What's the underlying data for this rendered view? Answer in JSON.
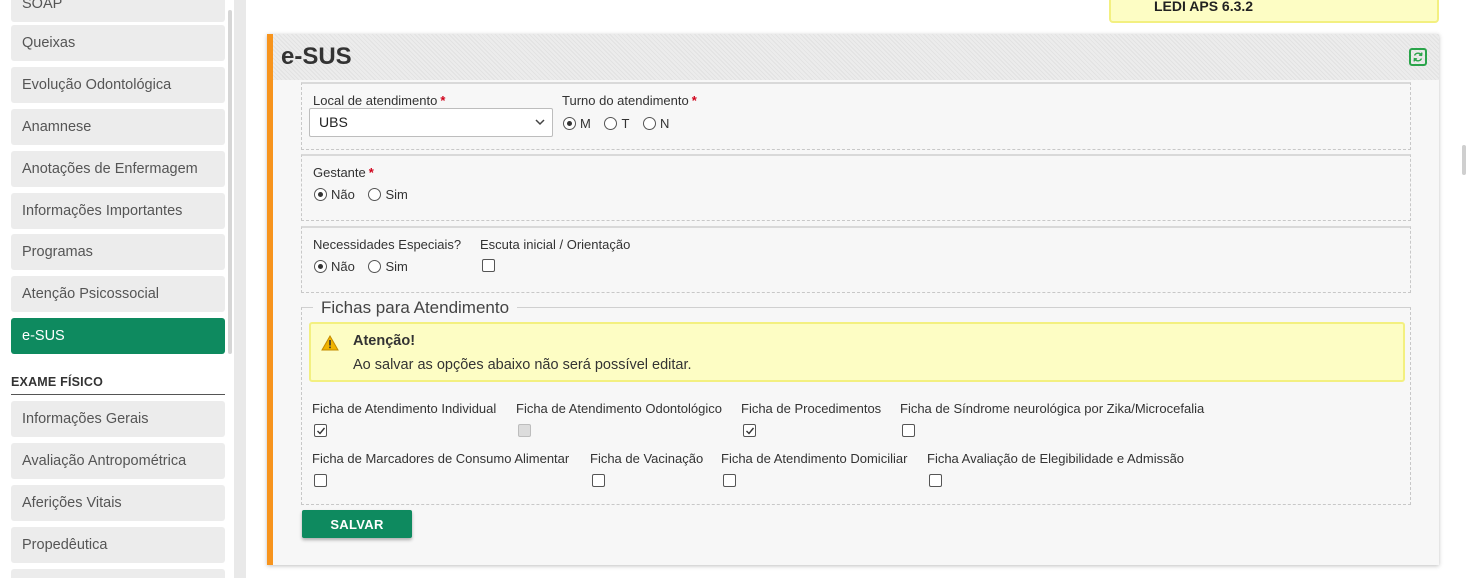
{
  "sidebar": {
    "items_top": [
      "SOAP",
      "Queixas",
      "Evolução Odontológica",
      "Anamnese",
      "Anotações de Enfermagem",
      "Informações Importantes",
      "Programas",
      "Atenção Psicossocial",
      "e-SUS"
    ],
    "active_item": "e-SUS",
    "section_header": "EXAME FÍSICO",
    "items_bottom": [
      "Informações Gerais",
      "Avaliação Antropométrica",
      "Aferições Vitais",
      "Propedêutica"
    ]
  },
  "version_label": "LEDI APS 6.3.2",
  "panel": {
    "title": "e-SUS",
    "refresh_icon": "refresh-icon"
  },
  "form": {
    "local_label": "Local de atendimento",
    "local_value": "UBS",
    "turno_label": "Turno do atendimento",
    "turno_options": [
      "M",
      "T",
      "N"
    ],
    "turno_selected": "M",
    "required_mark": "*",
    "gestante_label": "Gestante",
    "gestante_options": [
      "Não",
      "Sim"
    ],
    "gestante_selected": "Não",
    "necessidades_label": "Necessidades Especiais?",
    "necessidades_options": [
      "Não",
      "Sim"
    ],
    "necessidades_selected": "Não",
    "escuta_label": "Escuta inicial / Orientação",
    "escuta_checked": false
  },
  "fichas": {
    "legend": "Fichas para Atendimento",
    "alert_title": "Atenção!",
    "alert_text": "Ao salvar as opções abaixo não será possível editar.",
    "alert_color": "#fdfdc4",
    "row1": [
      {
        "label": "Ficha de Atendimento Individual",
        "checked": true,
        "disabled": false
      },
      {
        "label": "Ficha de Atendimento Odontológico",
        "checked": false,
        "disabled": true
      },
      {
        "label": "Ficha de Procedimentos",
        "checked": true,
        "disabled": false
      },
      {
        "label": "Ficha de Síndrome neurológica por Zika/Microcefalia",
        "checked": false,
        "disabled": false
      }
    ],
    "row2": [
      {
        "label": "Ficha de Marcadores de Consumo Alimentar",
        "checked": false,
        "disabled": false
      },
      {
        "label": "Ficha de Vacinação",
        "checked": false,
        "disabled": false
      },
      {
        "label": "Ficha de Atendimento Domiciliar",
        "checked": false,
        "disabled": false
      },
      {
        "label": "Ficha Avaliação de Elegibilidade e Admissão",
        "checked": false,
        "disabled": false
      }
    ]
  },
  "save_label": "SALVAR",
  "colors": {
    "primary": "#0e8a5f",
    "accent": "#f7941d",
    "required": "#d0021b"
  }
}
